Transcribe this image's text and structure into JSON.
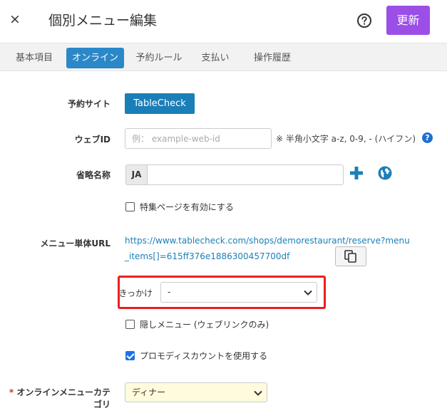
{
  "header": {
    "close_icon": "×",
    "title": "個別メニュー編集",
    "help_icon": "help-circle-icon",
    "update_label": "更新",
    "update_color": "#9b4fe6"
  },
  "tabs": [
    {
      "label": "基本項目",
      "active": false
    },
    {
      "label": "オンライン",
      "active": true
    },
    {
      "label": "予約ルール",
      "active": false
    },
    {
      "label": "支払い",
      "active": false
    },
    {
      "label": "操作履歴",
      "active": false
    }
  ],
  "form": {
    "reservation_site": {
      "label": "予約サイト",
      "button_label": "TableCheck"
    },
    "web_id": {
      "label": "ウェブID",
      "placeholder": "例： example-web-id",
      "value": "",
      "hint": "※ 半角小文字 a-z, 0-9, - (ハイフン)",
      "hint_icon": "?"
    },
    "short_name": {
      "label": "省略名称",
      "lang": "JA",
      "value": ""
    },
    "feature_page": {
      "label": "特集ページを有効にする",
      "checked": false
    },
    "menu_url": {
      "label": "メニュー単体URL",
      "url": "https://www.tablecheck.com/shops/demorestaurant/reserve?menu_items[]=615ff376e1886300457700df"
    },
    "trigger": {
      "label": "きっかけ",
      "selected": "-"
    },
    "hidden_menu": {
      "label": "隠しメニュー (ウェブリンクのみ)",
      "checked": false
    },
    "promo_discount": {
      "label": "プロモディスカウントを使用する",
      "checked": true
    },
    "online_category": {
      "required_mark": "*",
      "label": "オンラインメニューカテゴリ",
      "selected": "ディナー"
    }
  },
  "colors": {
    "accent_blue": "#1a7fb8",
    "active_tab": "#2b88c8",
    "highlight_red": "#e8201f",
    "category_select_bg": "#fffbdc"
  }
}
